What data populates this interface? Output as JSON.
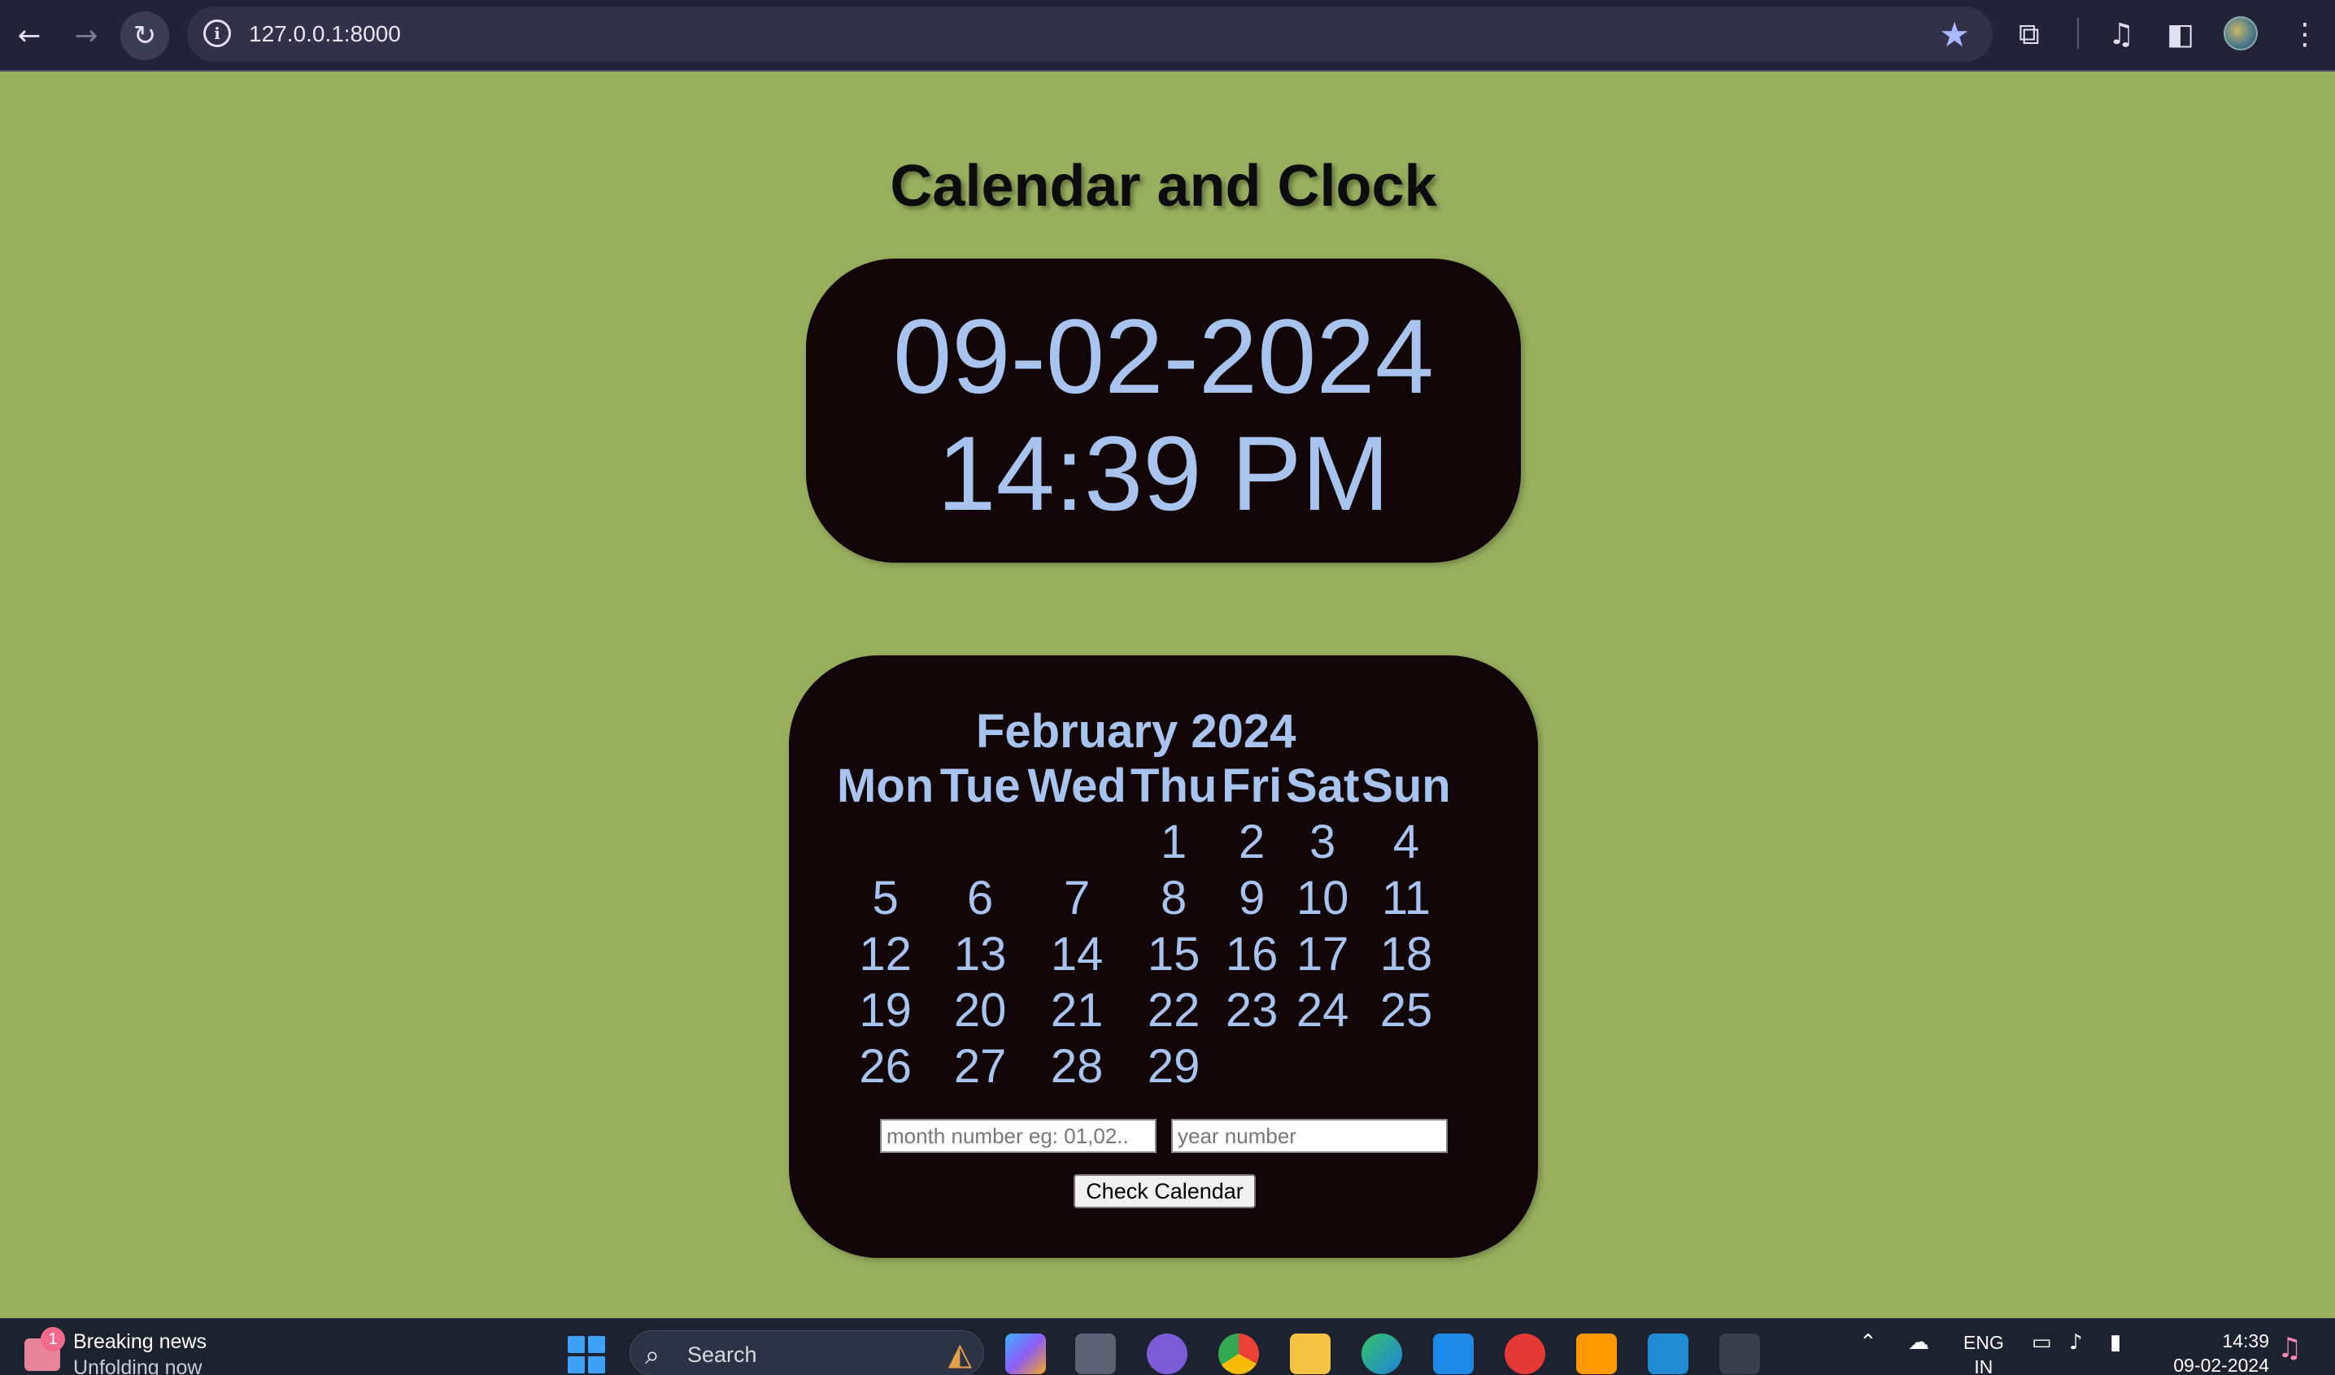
{
  "browser": {
    "url": "127.0.0.1:8000",
    "back_icon": "arrow-left-icon",
    "forward_icon": "arrow-right-icon",
    "reload_icon": "reload-icon"
  },
  "page": {
    "title": "Calendar and Clock",
    "clock": {
      "date": "09-02-2024",
      "time": "14:39 PM"
    },
    "calendar": {
      "month_title": "February 2024",
      "weekdays": [
        "Mon",
        "Tue",
        "Wed",
        "Thu",
        "Fri",
        "Sat",
        "Sun"
      ],
      "weeks": [
        [
          "",
          "",
          "",
          "1",
          "2",
          "3",
          "4"
        ],
        [
          "5",
          "6",
          "7",
          "8",
          "9",
          "10",
          "11"
        ],
        [
          "12",
          "13",
          "14",
          "15",
          "16",
          "17",
          "18"
        ],
        [
          "19",
          "20",
          "21",
          "22",
          "23",
          "24",
          "25"
        ],
        [
          "26",
          "27",
          "28",
          "29",
          "",
          "",
          ""
        ]
      ],
      "month_input_placeholder": "month number eg: 01,02..",
      "year_input_placeholder": "year number",
      "check_button_label": "Check Calendar"
    },
    "colors": {
      "background": "#98b05e",
      "panel": "#120508",
      "accent_text": "#a8c4ee"
    }
  },
  "taskbar": {
    "news_badge": "1",
    "news_title": "Breaking news",
    "news_subtitle": "Unfolding now",
    "search_label": "Search",
    "lang_line1": "ENG",
    "lang_line2": "IN",
    "time": "14:39",
    "date": "09-02-2024"
  }
}
